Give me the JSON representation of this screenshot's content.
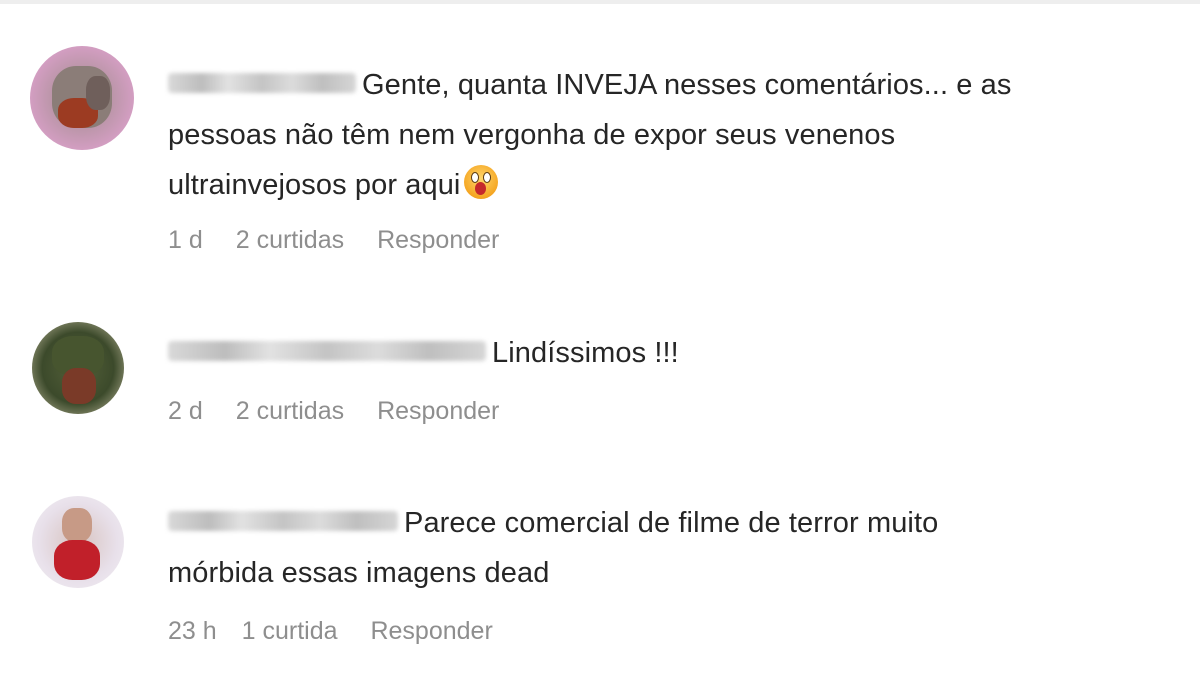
{
  "comments": [
    {
      "text_lines": [
        "Gente, quanta INVEJA nesses comentários... e as",
        "pessoas não têm nem vergonha de expor seus venenos",
        "ultrainvejosos por aqui"
      ],
      "time": "1 d",
      "likes": "2 curtidas",
      "reply": "Responder"
    },
    {
      "text_lines": [
        "Lindíssimos !!!"
      ],
      "time": "2 d",
      "likes": "2 curtidas",
      "reply": "Responder"
    },
    {
      "text_lines": [
        "Parece comercial de filme de terror muito",
        "mórbida essas imagens dead"
      ],
      "time": "23 h",
      "likes": "1 curtida",
      "reply": "Responder"
    }
  ],
  "icons": {
    "emoji": "astonished-face-emoji"
  }
}
